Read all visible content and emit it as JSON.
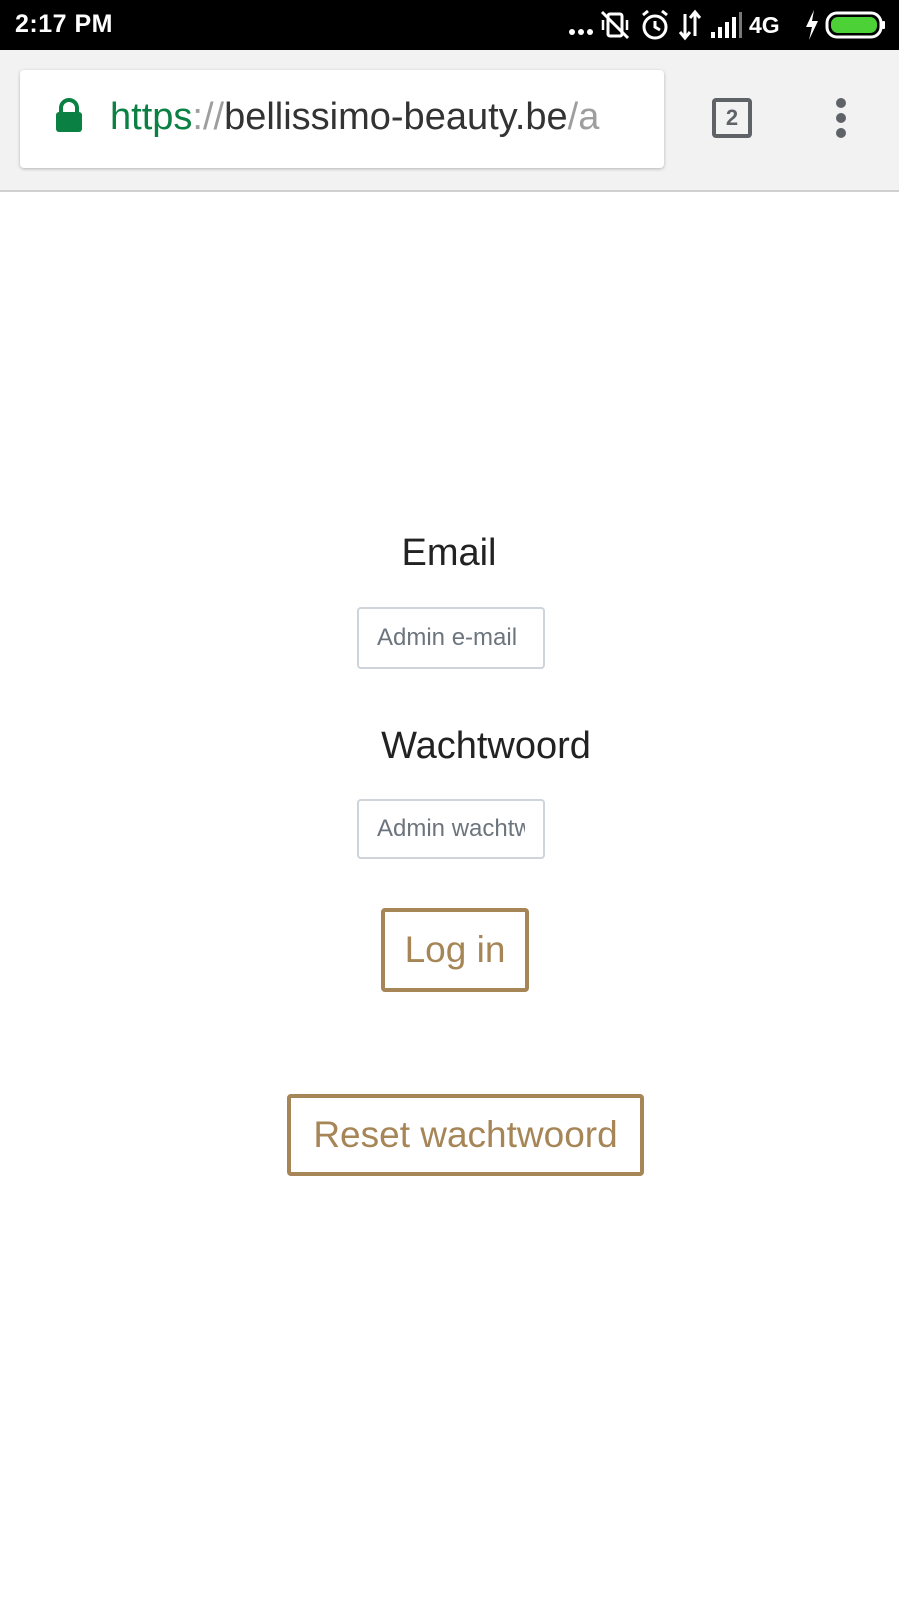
{
  "status_bar": {
    "time": "2:17 PM",
    "network": "4G",
    "icons": [
      "more-dots-icon",
      "vibrate-off-icon",
      "alarm-icon",
      "data-arrows-icon",
      "signal-icon",
      "charging-bolt-icon",
      "battery-icon"
    ]
  },
  "browser": {
    "url_scheme": "https",
    "url_sep": "://",
    "url_host": "bellissimo-beauty.be",
    "url_path": "/a",
    "tab_count": "2",
    "accent_secure": "#0b8043"
  },
  "form": {
    "email_label": "Email",
    "email_placeholder": "Admin e-mail",
    "password_label": "Wachtwoord",
    "password_placeholder": "Admin wachtwoord",
    "login_label": "Log in",
    "reset_label": "Reset wachtwoord",
    "button_color": "#a68556"
  }
}
